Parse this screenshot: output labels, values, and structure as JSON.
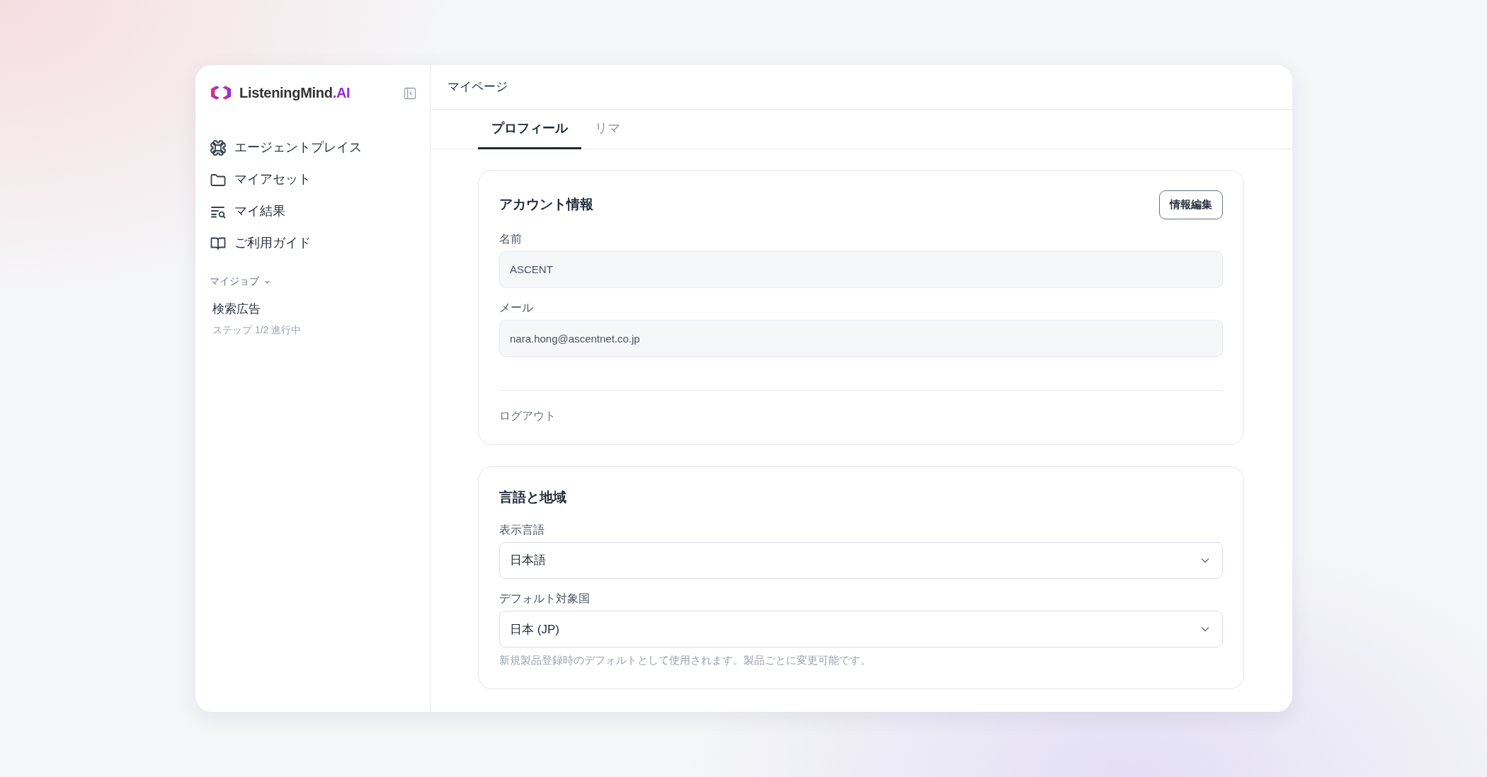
{
  "logo": {
    "name": "ListeningMind",
    "suffix": ".AI"
  },
  "sidebar": {
    "items": [
      {
        "label": "エージェントプレイス"
      },
      {
        "label": "マイアセット"
      },
      {
        "label": "マイ結果"
      },
      {
        "label": "ご利用ガイド"
      }
    ],
    "section": {
      "label": "マイジョブ",
      "expanded": true
    },
    "jobs": [
      {
        "title": "検索広告",
        "status": "ステップ 1/2 進行中"
      }
    ]
  },
  "page_title": "マイページ",
  "tabs": [
    {
      "label": "プロフィール",
      "selected": true
    },
    {
      "label": "リマ",
      "selected": false
    }
  ],
  "account": {
    "title": "アカウント情報",
    "edit_button": "情報編集",
    "fields": [
      {
        "label": "名前",
        "value": "ASCENT"
      },
      {
        "label": "メール",
        "value": "nara.hong@ascentnet.co.jp"
      }
    ],
    "logout": "ログアウト"
  },
  "locale": {
    "title": "言語と地域",
    "selects": [
      {
        "label": "表示言語",
        "value": "日本語"
      },
      {
        "label": "デフォルト対象国",
        "value": "日本 (JP)"
      }
    ],
    "hint": "新規製品登録時のデフォルトとして使用されます。製品ごとに変更可能です。"
  }
}
